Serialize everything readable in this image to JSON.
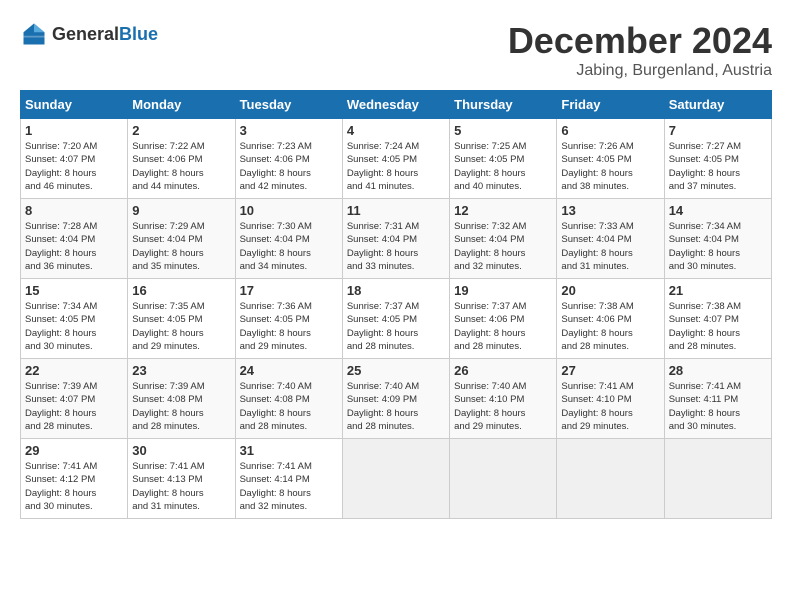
{
  "header": {
    "logo_general": "General",
    "logo_blue": "Blue",
    "month_title": "December 2024",
    "location": "Jabing, Burgenland, Austria"
  },
  "weekdays": [
    "Sunday",
    "Monday",
    "Tuesday",
    "Wednesday",
    "Thursday",
    "Friday",
    "Saturday"
  ],
  "weeks": [
    [
      {
        "day": "1",
        "info": "Sunrise: 7:20 AM\nSunset: 4:07 PM\nDaylight: 8 hours\nand 46 minutes."
      },
      {
        "day": "2",
        "info": "Sunrise: 7:22 AM\nSunset: 4:06 PM\nDaylight: 8 hours\nand 44 minutes."
      },
      {
        "day": "3",
        "info": "Sunrise: 7:23 AM\nSunset: 4:06 PM\nDaylight: 8 hours\nand 42 minutes."
      },
      {
        "day": "4",
        "info": "Sunrise: 7:24 AM\nSunset: 4:05 PM\nDaylight: 8 hours\nand 41 minutes."
      },
      {
        "day": "5",
        "info": "Sunrise: 7:25 AM\nSunset: 4:05 PM\nDaylight: 8 hours\nand 40 minutes."
      },
      {
        "day": "6",
        "info": "Sunrise: 7:26 AM\nSunset: 4:05 PM\nDaylight: 8 hours\nand 38 minutes."
      },
      {
        "day": "7",
        "info": "Sunrise: 7:27 AM\nSunset: 4:05 PM\nDaylight: 8 hours\nand 37 minutes."
      }
    ],
    [
      {
        "day": "8",
        "info": "Sunrise: 7:28 AM\nSunset: 4:04 PM\nDaylight: 8 hours\nand 36 minutes."
      },
      {
        "day": "9",
        "info": "Sunrise: 7:29 AM\nSunset: 4:04 PM\nDaylight: 8 hours\nand 35 minutes."
      },
      {
        "day": "10",
        "info": "Sunrise: 7:30 AM\nSunset: 4:04 PM\nDaylight: 8 hours\nand 34 minutes."
      },
      {
        "day": "11",
        "info": "Sunrise: 7:31 AM\nSunset: 4:04 PM\nDaylight: 8 hours\nand 33 minutes."
      },
      {
        "day": "12",
        "info": "Sunrise: 7:32 AM\nSunset: 4:04 PM\nDaylight: 8 hours\nand 32 minutes."
      },
      {
        "day": "13",
        "info": "Sunrise: 7:33 AM\nSunset: 4:04 PM\nDaylight: 8 hours\nand 31 minutes."
      },
      {
        "day": "14",
        "info": "Sunrise: 7:34 AM\nSunset: 4:04 PM\nDaylight: 8 hours\nand 30 minutes."
      }
    ],
    [
      {
        "day": "15",
        "info": "Sunrise: 7:34 AM\nSunset: 4:05 PM\nDaylight: 8 hours\nand 30 minutes."
      },
      {
        "day": "16",
        "info": "Sunrise: 7:35 AM\nSunset: 4:05 PM\nDaylight: 8 hours\nand 29 minutes."
      },
      {
        "day": "17",
        "info": "Sunrise: 7:36 AM\nSunset: 4:05 PM\nDaylight: 8 hours\nand 29 minutes."
      },
      {
        "day": "18",
        "info": "Sunrise: 7:37 AM\nSunset: 4:05 PM\nDaylight: 8 hours\nand 28 minutes."
      },
      {
        "day": "19",
        "info": "Sunrise: 7:37 AM\nSunset: 4:06 PM\nDaylight: 8 hours\nand 28 minutes."
      },
      {
        "day": "20",
        "info": "Sunrise: 7:38 AM\nSunset: 4:06 PM\nDaylight: 8 hours\nand 28 minutes."
      },
      {
        "day": "21",
        "info": "Sunrise: 7:38 AM\nSunset: 4:07 PM\nDaylight: 8 hours\nand 28 minutes."
      }
    ],
    [
      {
        "day": "22",
        "info": "Sunrise: 7:39 AM\nSunset: 4:07 PM\nDaylight: 8 hours\nand 28 minutes."
      },
      {
        "day": "23",
        "info": "Sunrise: 7:39 AM\nSunset: 4:08 PM\nDaylight: 8 hours\nand 28 minutes."
      },
      {
        "day": "24",
        "info": "Sunrise: 7:40 AM\nSunset: 4:08 PM\nDaylight: 8 hours\nand 28 minutes."
      },
      {
        "day": "25",
        "info": "Sunrise: 7:40 AM\nSunset: 4:09 PM\nDaylight: 8 hours\nand 28 minutes."
      },
      {
        "day": "26",
        "info": "Sunrise: 7:40 AM\nSunset: 4:10 PM\nDaylight: 8 hours\nand 29 minutes."
      },
      {
        "day": "27",
        "info": "Sunrise: 7:41 AM\nSunset: 4:10 PM\nDaylight: 8 hours\nand 29 minutes."
      },
      {
        "day": "28",
        "info": "Sunrise: 7:41 AM\nSunset: 4:11 PM\nDaylight: 8 hours\nand 30 minutes."
      }
    ],
    [
      {
        "day": "29",
        "info": "Sunrise: 7:41 AM\nSunset: 4:12 PM\nDaylight: 8 hours\nand 30 minutes."
      },
      {
        "day": "30",
        "info": "Sunrise: 7:41 AM\nSunset: 4:13 PM\nDaylight: 8 hours\nand 31 minutes."
      },
      {
        "day": "31",
        "info": "Sunrise: 7:41 AM\nSunset: 4:14 PM\nDaylight: 8 hours\nand 32 minutes."
      },
      {
        "day": "",
        "info": ""
      },
      {
        "day": "",
        "info": ""
      },
      {
        "day": "",
        "info": ""
      },
      {
        "day": "",
        "info": ""
      }
    ]
  ]
}
